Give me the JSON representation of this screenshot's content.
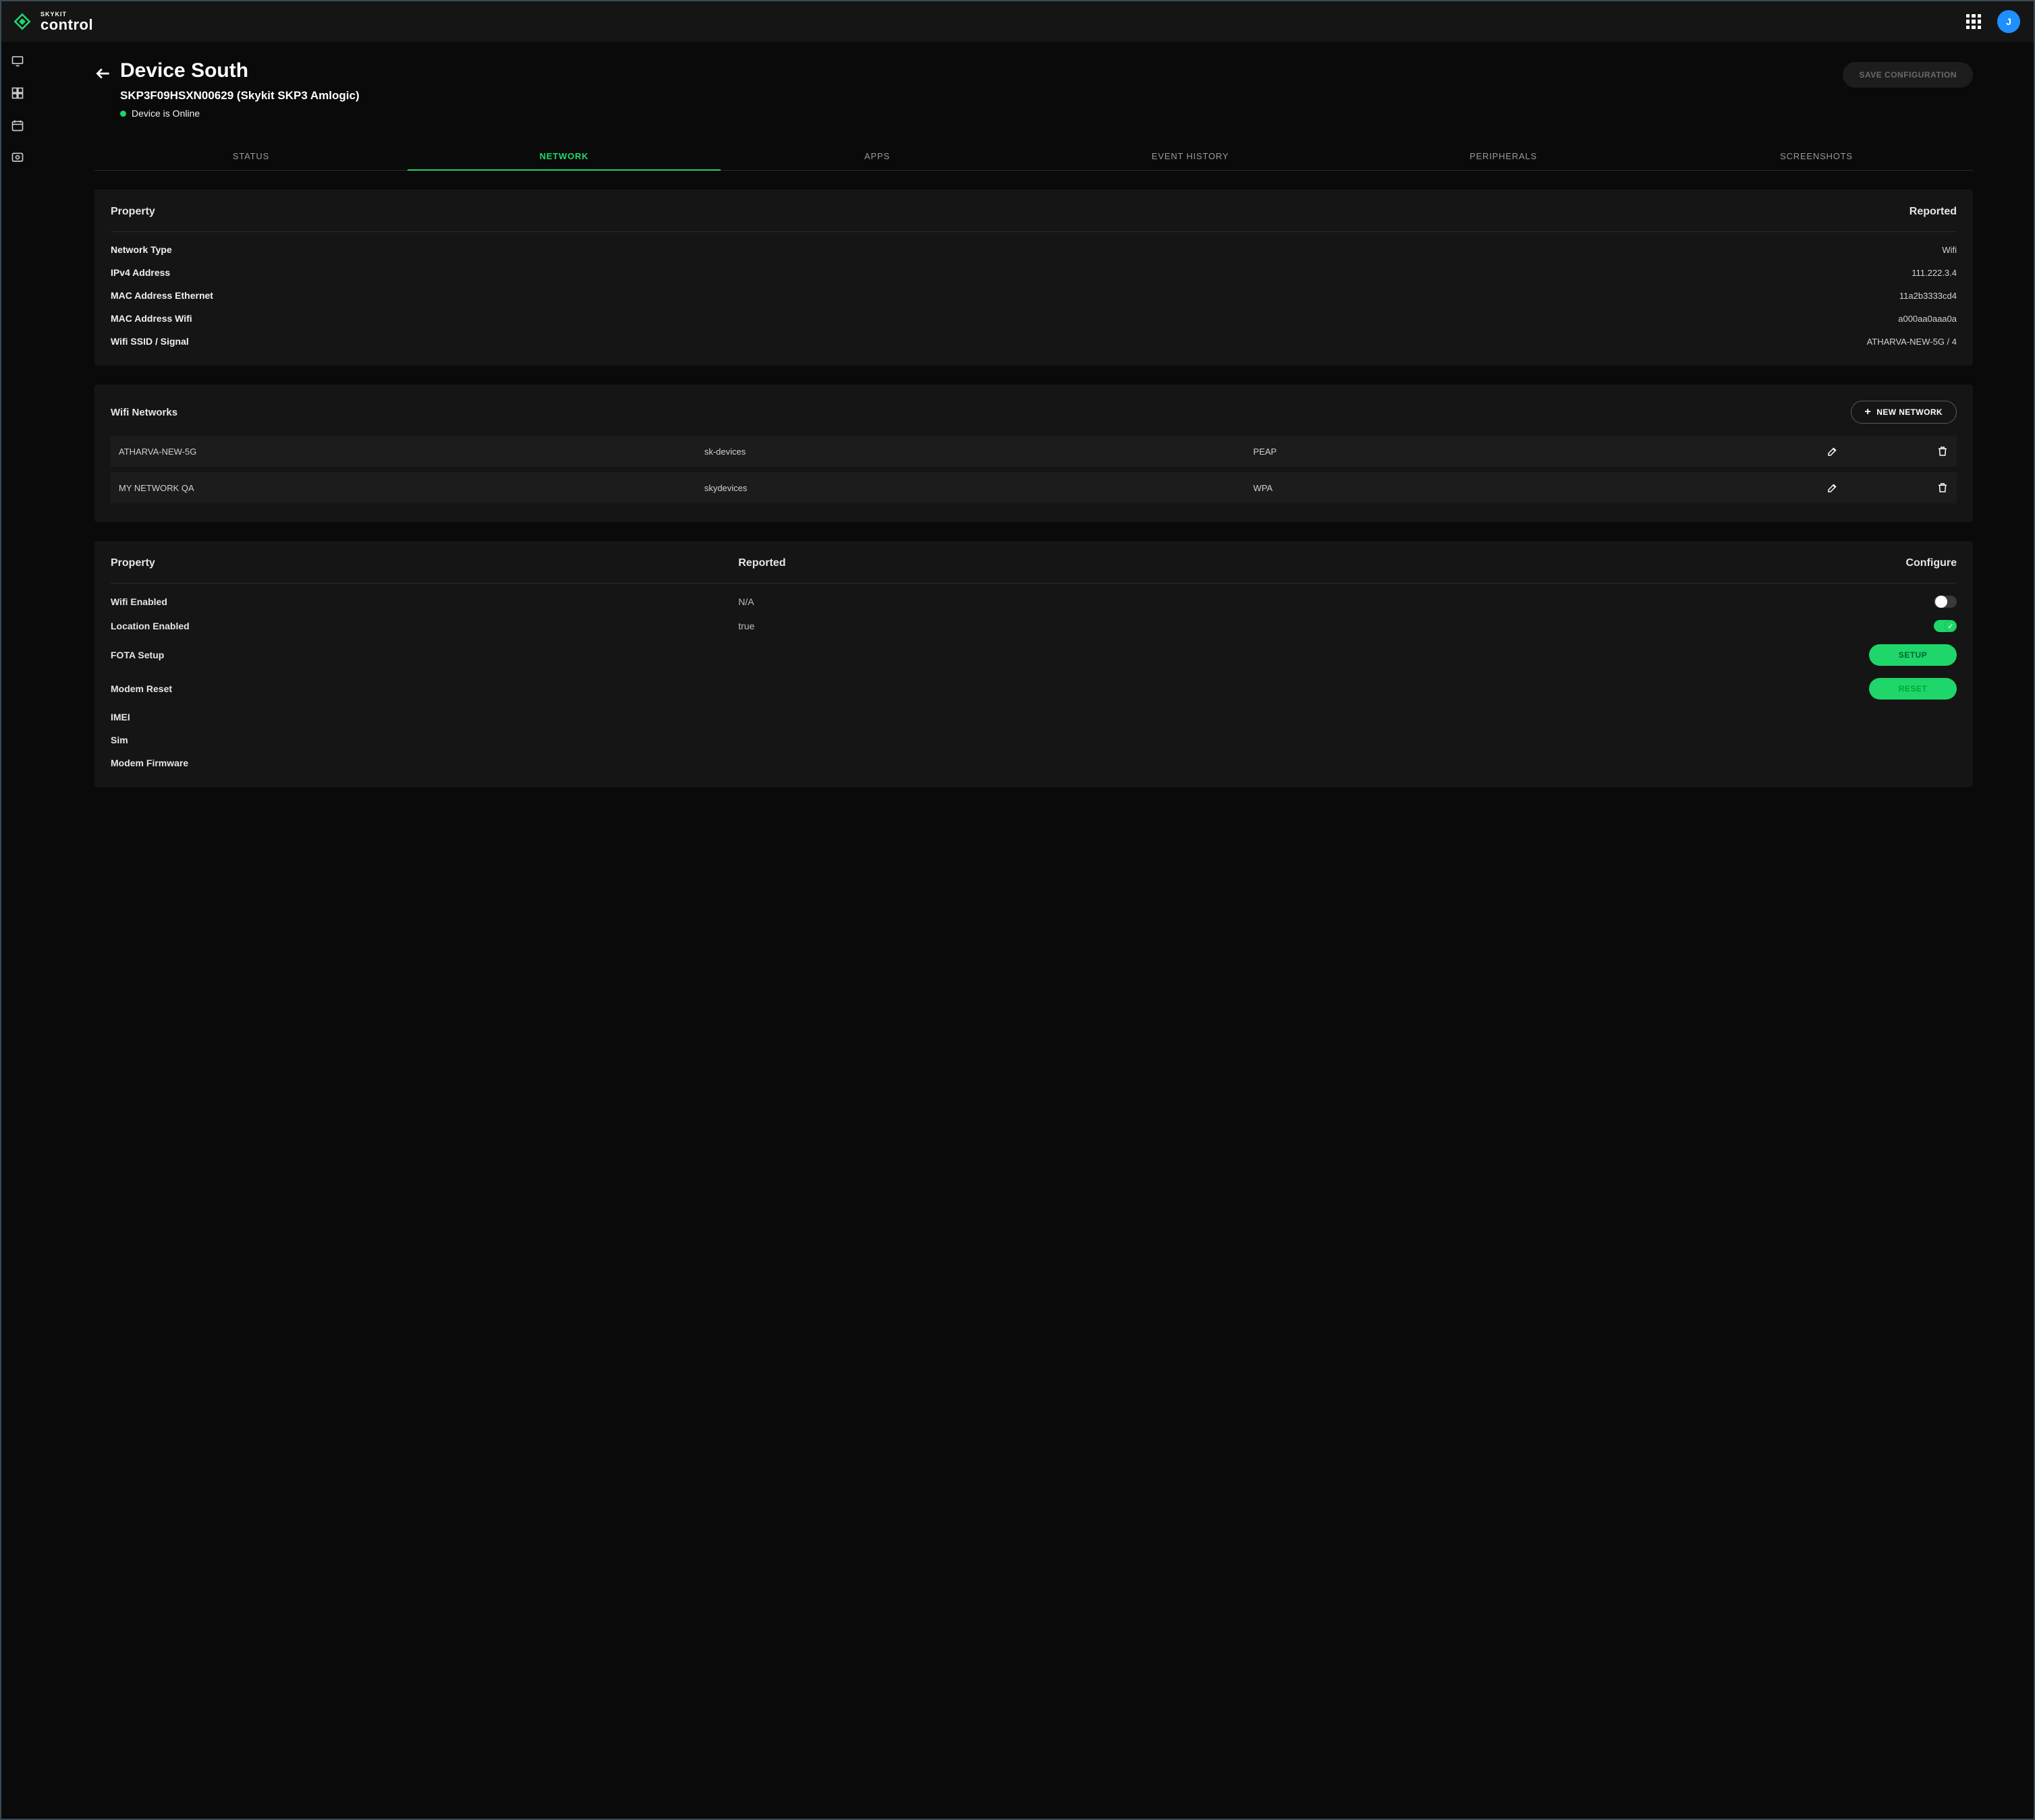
{
  "brand": {
    "small": "SKYKIT",
    "big": "control"
  },
  "avatar_initial": "J",
  "page": {
    "title": "Device South",
    "subtitle": "SKP3F09HSXN00629 (Skykit SKP3 Amlogic)",
    "status_text": "Device is Online",
    "save_label": "SAVE CONFIGURATION"
  },
  "tabs": [
    "STATUS",
    "NETWORK",
    "APPS",
    "EVENT HISTORY",
    "PERIPHERALS",
    "SCREENSHOTS"
  ],
  "active_tab_index": 1,
  "net_panel": {
    "col_left": "Property",
    "col_right": "Reported",
    "rows": [
      {
        "label": "Network Type",
        "value": "Wifi"
      },
      {
        "label": "IPv4 Address",
        "value": "111.222.3.4"
      },
      {
        "label": "MAC Address Ethernet",
        "value": "11a2b3333cd4"
      },
      {
        "label": "MAC Address Wifi",
        "value": "a000aa0aaa0a"
      },
      {
        "label": "Wifi SSID / Signal",
        "value": "ATHARVA-NEW-5G / 4"
      }
    ]
  },
  "wifi_panel": {
    "title": "Wifi Networks",
    "new_label": "NEW NETWORK",
    "rows": [
      {
        "ssid": "ATHARVA-NEW-5G",
        "ident": "sk-devices",
        "security": "PEAP"
      },
      {
        "ssid": "MY NETWORK QA",
        "ident": "skydevices",
        "security": "WPA"
      }
    ]
  },
  "cfg_panel": {
    "col_prop": "Property",
    "col_rep": "Reported",
    "col_cfg": "Configure",
    "wifi_enabled": {
      "label": "Wifi Enabled",
      "value": "N/A"
    },
    "location_enabled": {
      "label": "Location Enabled",
      "value": "true"
    },
    "fota": {
      "label": "FOTA Setup",
      "btn": "SETUP"
    },
    "modem_reset": {
      "label": "Modem Reset",
      "btn": "RESET"
    },
    "imei": "IMEI",
    "sim": "Sim",
    "modem_fw": "Modem Firmware"
  }
}
